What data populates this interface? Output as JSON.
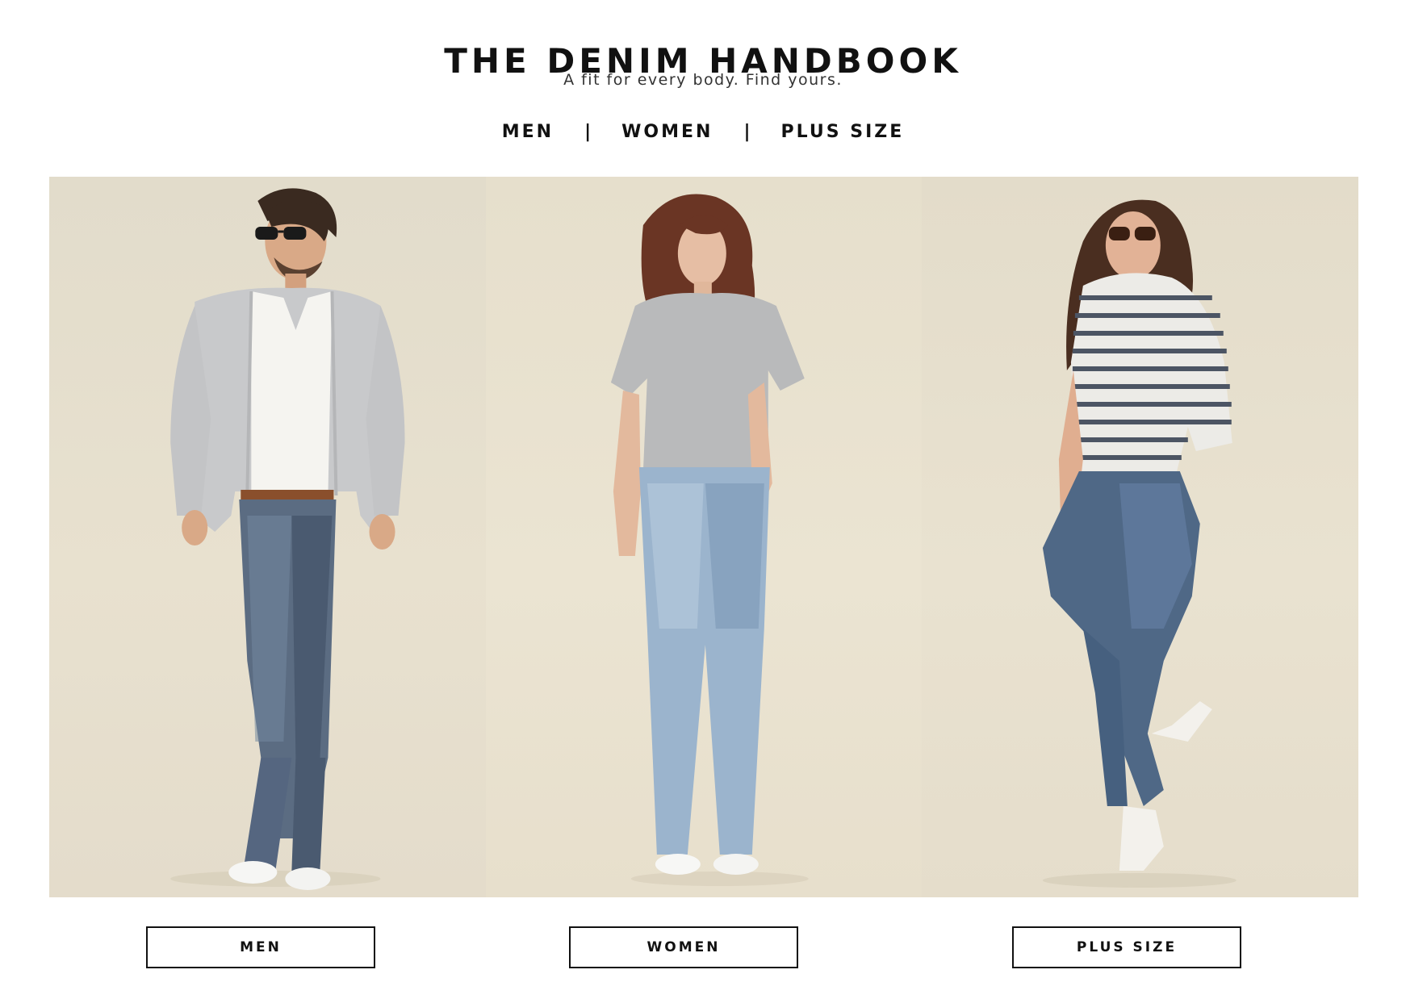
{
  "header": {
    "title": "THE DENIM HANDBOOK",
    "subtitle": "A fit for every body. Find yours."
  },
  "nav": {
    "items": [
      {
        "label": "MEN"
      },
      {
        "label": "WOMEN"
      },
      {
        "label": "PLUS SIZE"
      }
    ],
    "separator": "|"
  },
  "gallery": {
    "panels": [
      {
        "subject": "men-model-photo",
        "background": "#e6dfcd"
      },
      {
        "subject": "women-model-photo",
        "background": "#e9e2cf"
      },
      {
        "subject": "plus-size-model-photo",
        "background": "#e7e0ce"
      }
    ]
  },
  "cta": {
    "buttons": [
      {
        "label": "MEN"
      },
      {
        "label": "WOMEN"
      },
      {
        "label": "PLUS SIZE"
      }
    ]
  },
  "colors": {
    "text": "#111111",
    "backdrop": "#e6dfcd",
    "denim_dark": "#4a5a70",
    "denim_light": "#8fa9c4"
  }
}
